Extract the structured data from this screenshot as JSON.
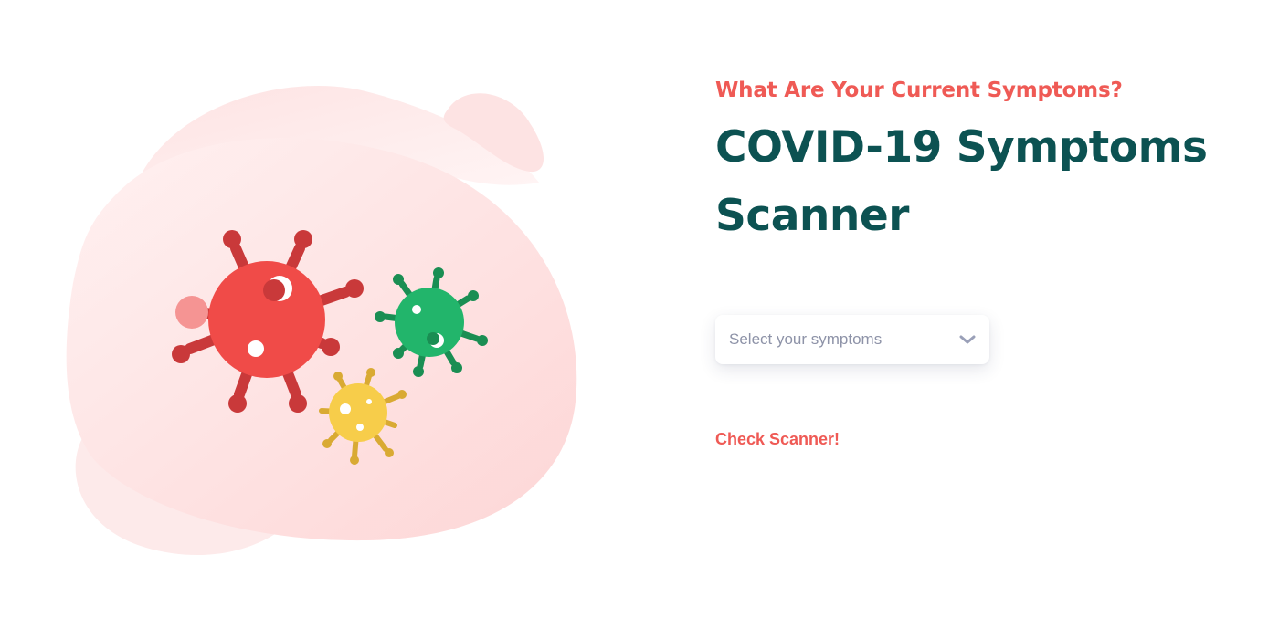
{
  "hero": {
    "eyebrow": "What Are Your Current Symptoms?",
    "title_line1": "COVID-19 Symptoms",
    "title_line2": "Scanner"
  },
  "symptom_select": {
    "placeholder": "Select your symptoms",
    "icon": "chevron-down-icon"
  },
  "cta": {
    "label": "Check Scanner!"
  },
  "illustration": {
    "description_icon": "virus-illustration",
    "colors": {
      "blob": "#fde1e1",
      "virus_red": "#f04b48",
      "virus_green": "#22b56b",
      "virus_yellow": "#f7cd4a"
    }
  },
  "colors": {
    "accent": "#ef5a55",
    "heading": "#0c5252",
    "placeholder": "#8e93a8",
    "chevron": "#9aa0b8"
  }
}
